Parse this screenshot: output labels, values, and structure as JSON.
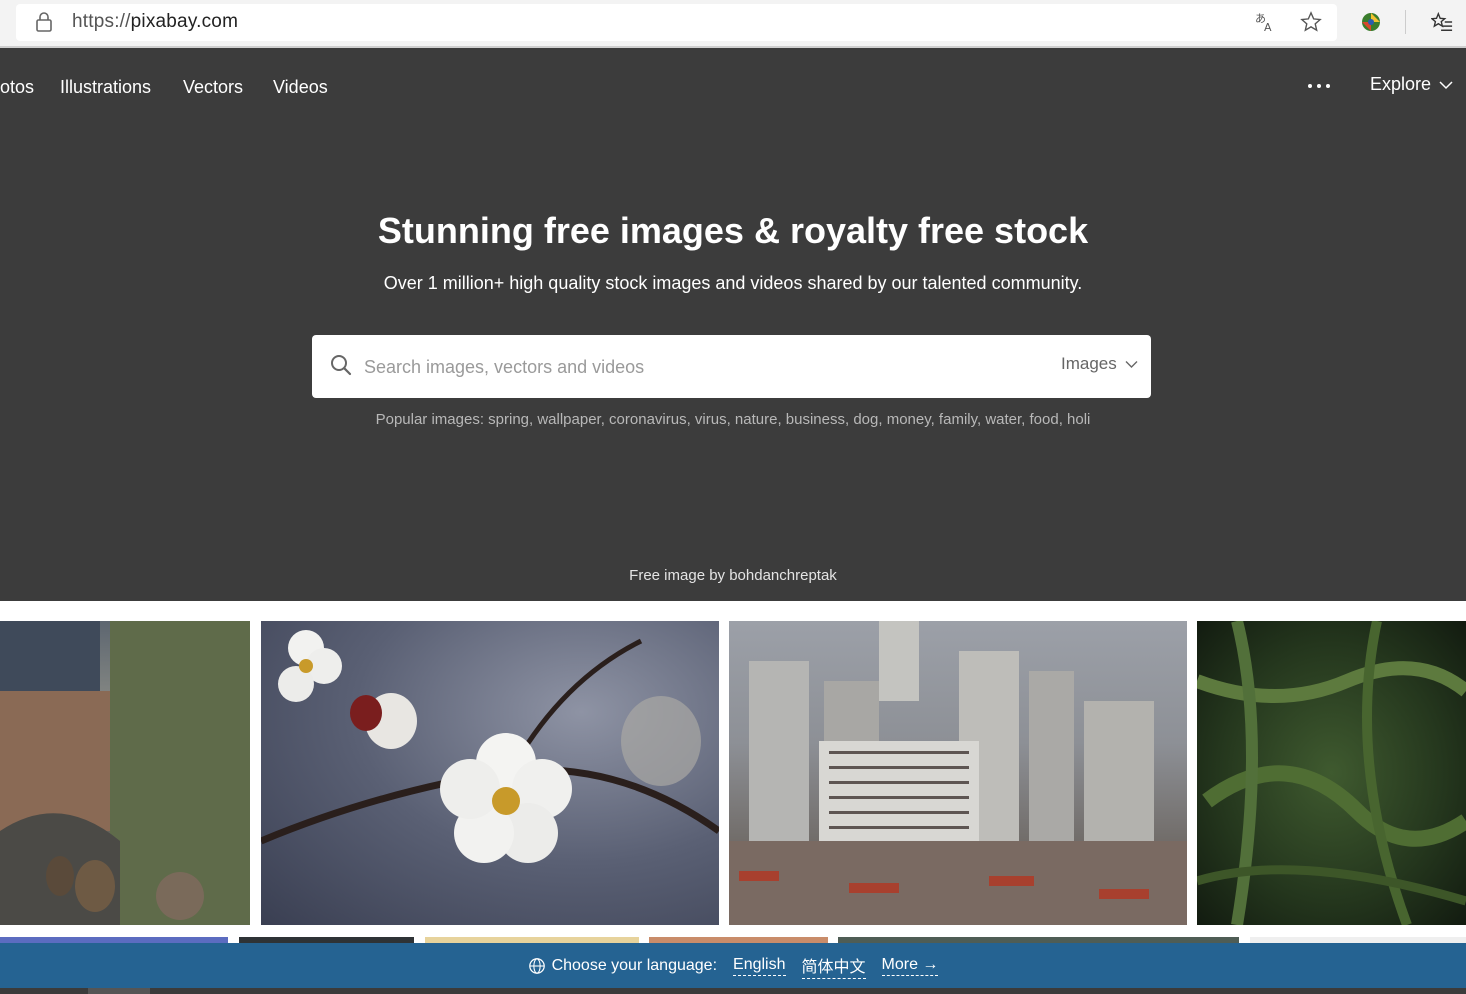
{
  "browser": {
    "url_protocol": "https://",
    "url_host": "pixabay.com",
    "icons": [
      "lock-icon",
      "translate-icon",
      "star-icon",
      "extension-icon",
      "favorites-icon"
    ]
  },
  "nav": {
    "items": [
      "otos",
      "Illustrations",
      "Vectors",
      "Videos"
    ],
    "explore_label": "Explore"
  },
  "hero": {
    "title": "Stunning free images & royalty free stock",
    "subtitle": "Over 1 million+ high quality stock images and videos shared by our talented community.",
    "search_placeholder": "Search images, vectors and videos",
    "search_type": "Images",
    "popular": "Popular images: spring, wallpaper, coronavirus, virus, nature, business, dog, money, family, water, food, holi",
    "credit": "Free image by bohdanchreptak"
  },
  "language_bar": {
    "label": "Choose your language:",
    "options": [
      "English",
      "简体中文"
    ],
    "more": "More →"
  },
  "colors": {
    "hero_bg": "#3c3c3c",
    "lang_bar_bg": "#256392"
  }
}
